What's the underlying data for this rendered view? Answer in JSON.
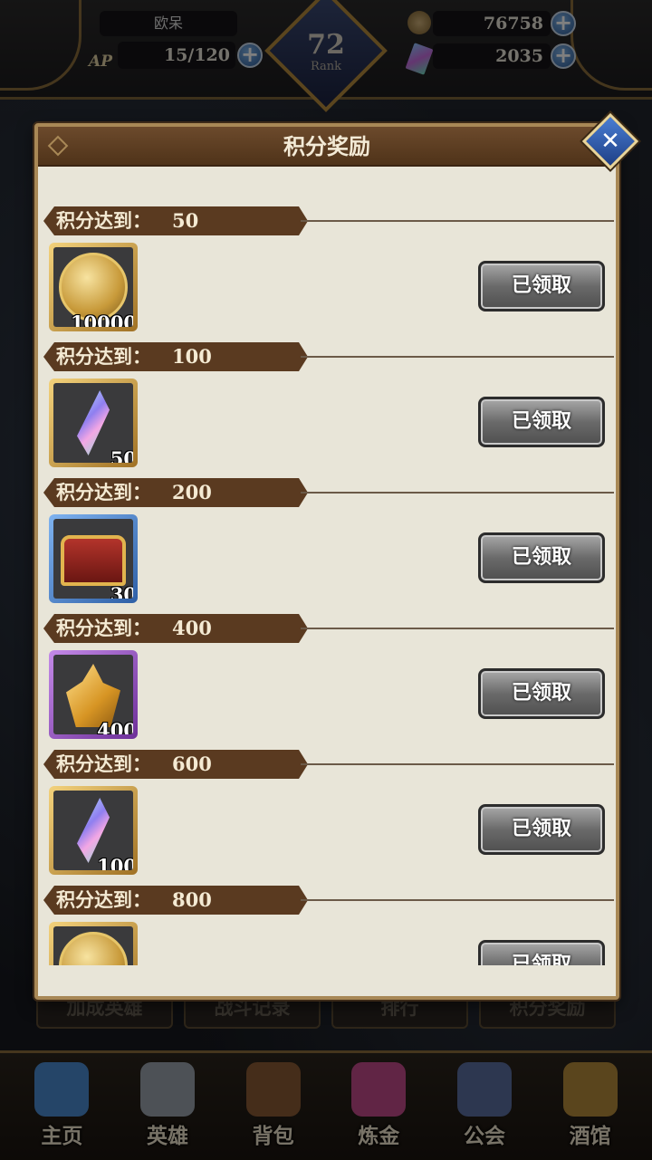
{
  "hud": {
    "player_name": "欧呆",
    "ap_label": "AP",
    "ap_value": "15/120",
    "rank_value": "72",
    "rank_label": "Rank",
    "gold": "76758",
    "gems": "2035"
  },
  "under_tabs": [
    "加成英雄",
    "战斗记录",
    "排行",
    "积分奖励"
  ],
  "bottom_nav": [
    {
      "label": "主页",
      "icon": "castle-icon",
      "color": "#4a8bd0"
    },
    {
      "label": "英雄",
      "icon": "helmet-icon",
      "color": "#9aa3ad"
    },
    {
      "label": "背包",
      "icon": "backpack-icon",
      "color": "#8a5a34"
    },
    {
      "label": "炼金",
      "icon": "flask-icon",
      "color": "#c24a8a"
    },
    {
      "label": "公会",
      "icon": "shield-icon",
      "color": "#5a6ea0"
    },
    {
      "label": "酒馆",
      "icon": "beer-mug-icon",
      "color": "#b58a3a"
    }
  ],
  "dialog": {
    "title": "积分奖励",
    "close_icon": "close-icon",
    "tier_label": "积分达到：",
    "tiers": [
      {
        "points": "50",
        "qty": "10000",
        "item": "gold-coin-icon",
        "frame": "gold",
        "button": "已领取"
      },
      {
        "points": "100",
        "qty": "50",
        "item": "crystal-icon",
        "frame": "gold",
        "button": "已领取"
      },
      {
        "points": "200",
        "qty": "30",
        "item": "treasure-chest-icon",
        "frame": "blue",
        "button": "已领取"
      },
      {
        "points": "400",
        "qty": "400",
        "item": "amber-crystal-icon",
        "frame": "purple",
        "button": "已领取"
      },
      {
        "points": "600",
        "qty": "100",
        "item": "crystal-icon",
        "frame": "gold",
        "button": "已领取"
      },
      {
        "points": "800",
        "qty": "",
        "item": "gold-coin-icon",
        "frame": "gold",
        "button": "已领取"
      }
    ]
  }
}
